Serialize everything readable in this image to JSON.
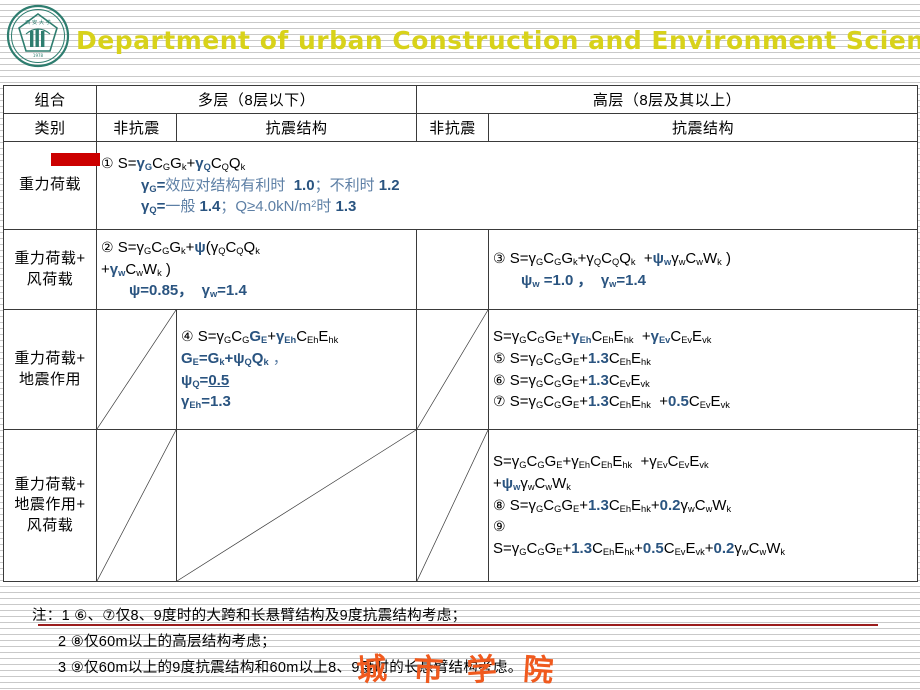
{
  "header": {
    "title": "Department of urban Construction and Environment Science",
    "title_color": "#d8d21a",
    "logo_name": "university-seal-logo",
    "logo_color": "#2e7d6f"
  },
  "table": {
    "col_group_label": "组合",
    "col_group_label2": "类别",
    "groups": [
      {
        "label": "多层（8层以下）",
        "shaded": false
      },
      {
        "label": "高层（8层及其以上）",
        "shaded": true
      }
    ],
    "subheaders": [
      {
        "label": "非抗震",
        "shaded": false
      },
      {
        "label": "抗震结构",
        "shaded": false
      },
      {
        "label": "非抗震",
        "shaded": true
      },
      {
        "label": "抗震结构",
        "shaded": true
      }
    ],
    "rows": [
      {
        "category": "重力荷载",
        "marker_color": "#cc0000",
        "shaded": true,
        "lines": [
          "① S=γGCGGk+γQCQQk",
          "γG=效应对结构有利时  1.0；不利时 1.2",
          "γQ=一般 1.4；Q≥4.0kN/m2时 1.3"
        ]
      },
      {
        "category": "重力荷载+\n风荷载",
        "left_lines": [
          "② S=γGCGGk+ψ(γQCQQk",
          "+γwCwWk )",
          "ψ=0.85，  γw=1.4"
        ],
        "right_lines": [
          "③ S=γGCGGk+γQCQQk  +ψwγwCwWk )",
          "ψw =1.0 ，  γw=1.4"
        ]
      },
      {
        "category": "重力荷载+\n地震作用",
        "left_lines": [
          "④ S=γGCGGE+γEhCEhEhk",
          "GE=Gk+ψQQk ，",
          "ψQ=0.5",
          "γEh=1.3"
        ],
        "right_lines": [
          "S=γGCGGE+γEhCEhEhk  +γEvCEvEvk",
          "⑤ S=γGCGGE+1.3CEhEhk",
          "⑥ S=γGCGGE+1.3CEvEvk",
          "⑦ S=γGCGGE+1.3CEhEhk  +0.5CEvEvk"
        ]
      },
      {
        "category": "重力荷载+\n地震作用+\n风荷载",
        "right_lines": [
          "S=γGCGGE+γEhCEhEhk  +γEvCEvEvk",
          "+ψwγwCwWk",
          "⑧ S=γGCGGE+1.3CEhEhk+0.2γwCwWk",
          "⑨",
          "S=γGCGGE+1.3CEhEhk+0.5CEvEvk+0.2γwCwWk"
        ]
      }
    ]
  },
  "notes": {
    "note1": "注：1 ⑥、⑦仅8、9度时的大跨和长悬臂结构及9度抗震结构考虑；",
    "note2": "2 ⑧仅60m以上的高层结构考虑；",
    "note3": "3 ⑨仅60m以上的9度抗震结构和60m以上8、9度时的长悬臂结构考虑。",
    "underline_color": "#9b1c1c"
  },
  "watermark": {
    "text": "城市学院",
    "color": "#f05a1e"
  },
  "colors": {
    "shaded_cell": "#a6b6c6",
    "accent_blue": "#2a5480",
    "light_blue": "#5d7fa5",
    "marker_red": "#cc0000"
  }
}
